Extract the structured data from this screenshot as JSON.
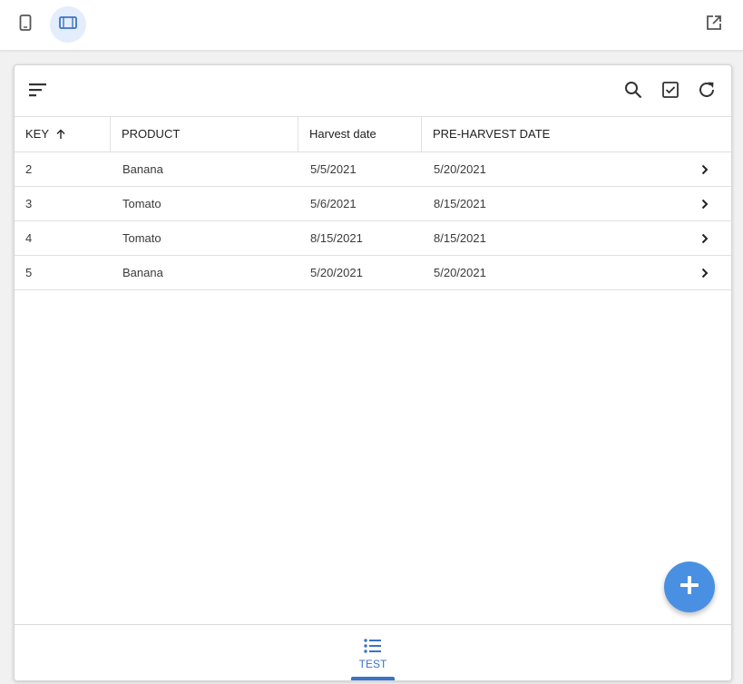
{
  "colors": {
    "accent": "#3b73c4",
    "fab": "#4a90e2",
    "active_toggle_bg": "#e3edfb"
  },
  "topbar": {
    "icons": [
      "phone-icon",
      "tablet-icon",
      "open-in-new-icon"
    ],
    "active_view": "tablet"
  },
  "toolbar": {
    "icons": [
      "sort-icon",
      "search-icon",
      "select-checkbox-icon",
      "refresh-icon"
    ]
  },
  "table": {
    "columns": [
      {
        "label": "KEY",
        "sort": "ascending"
      },
      {
        "label": "PRODUCT"
      },
      {
        "label": "Harvest date"
      },
      {
        "label": "PRE-HARVEST DATE"
      }
    ],
    "rows": [
      {
        "key": "2",
        "product": "Banana",
        "harvest": "5/5/2021",
        "preharvest": "5/20/2021"
      },
      {
        "key": "3",
        "product": "Tomato",
        "harvest": "5/6/2021",
        "preharvest": "8/15/2021"
      },
      {
        "key": "4",
        "product": "Tomato",
        "harvest": "8/15/2021",
        "preharvest": "8/15/2021"
      },
      {
        "key": "5",
        "product": "Banana",
        "harvest": "5/20/2021",
        "preharvest": "5/20/2021"
      }
    ]
  },
  "fab": {
    "icon": "plus-icon"
  },
  "bottom_nav": {
    "tabs": [
      {
        "label": "TEST",
        "icon": "list-icon",
        "active": true
      }
    ]
  }
}
